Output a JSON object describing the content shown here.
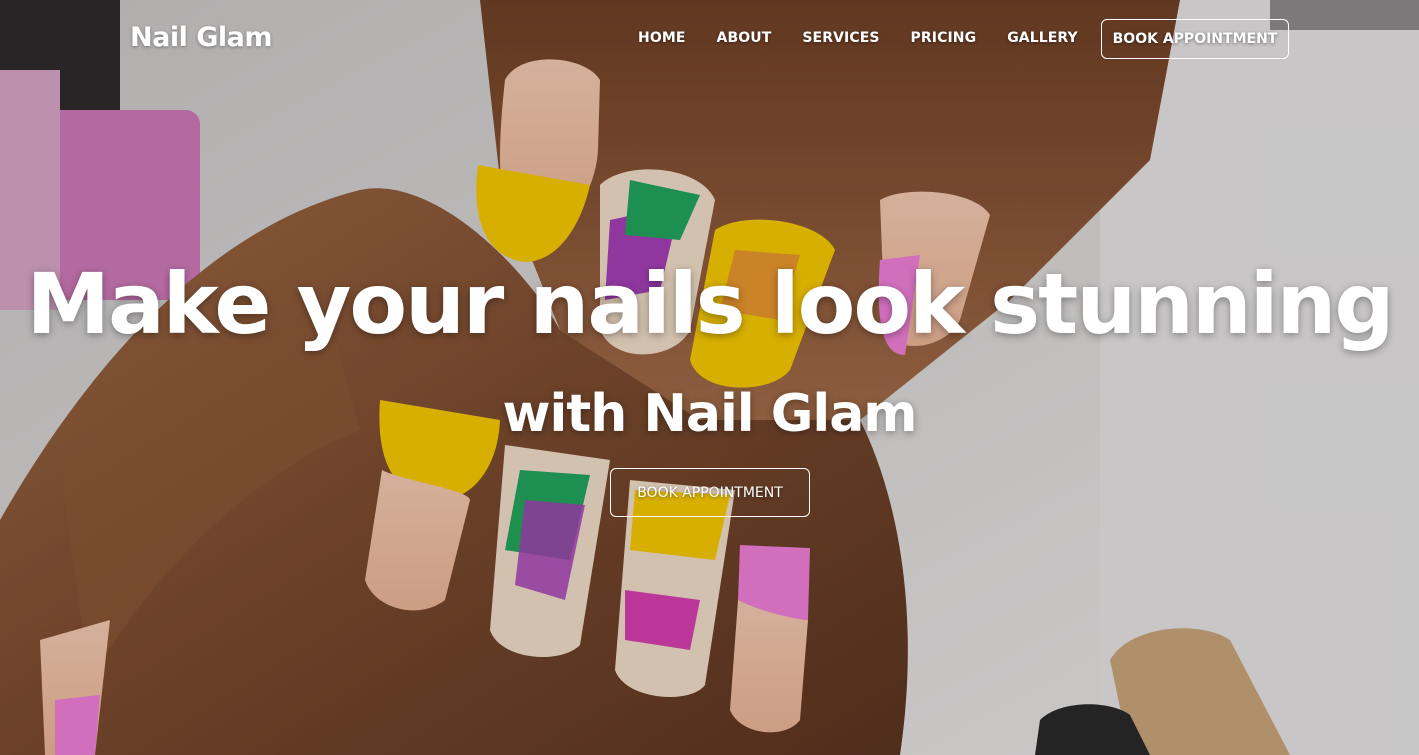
{
  "nav": {
    "brand": "Nail Glam",
    "items": [
      {
        "label": "HOME"
      },
      {
        "label": "ABOUT"
      },
      {
        "label": "SERVICES"
      },
      {
        "label": "PRICING"
      },
      {
        "label": "GALLERY"
      }
    ],
    "cta_label": "BOOK APPOINTMENT"
  },
  "hero": {
    "title": "Make your nails look stunning",
    "subtitle": "with Nail Glam",
    "cta_label": "BOOK APPOINTMENT",
    "image": "manicured-hands-photo"
  },
  "colors": {
    "text": "#ffffff",
    "nail_yellow": "#f5c800",
    "nail_pink": "#ee7fd6",
    "skin": "#8a5a3c"
  }
}
